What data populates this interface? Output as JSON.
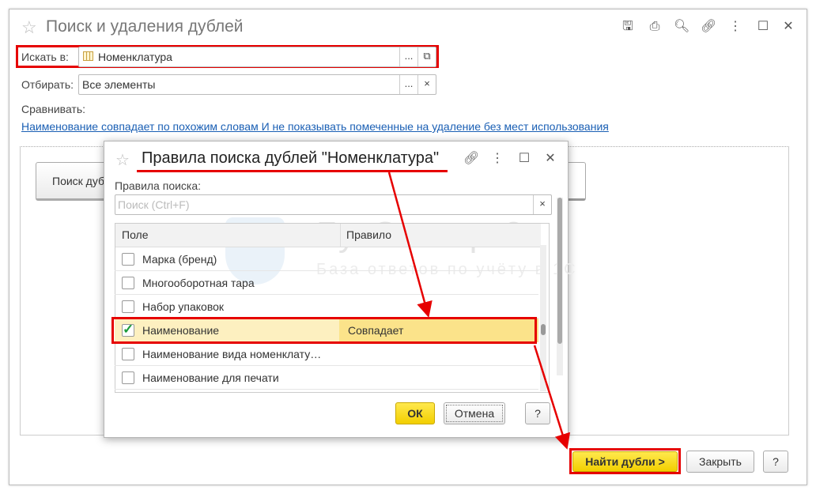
{
  "window": {
    "title": "Поиск и удаления дублей",
    "toolbar_icons": [
      "save-icon",
      "print-icon",
      "preview-icon",
      "link-icon",
      "more-icon",
      "maximize-icon",
      "close-icon"
    ]
  },
  "search_in": {
    "label": "Искать в:",
    "value": "Номенклатура",
    "select_btn": "...",
    "open_btn": "⧉"
  },
  "filter": {
    "label": "Отбирать:",
    "value": "Все элементы",
    "select_btn": "...",
    "clear_btn": "×"
  },
  "compare": {
    "label": "Сравнивать:",
    "link": "Наименование совпадает по похожим словам И не показывать помеченные на удаление без мест использования"
  },
  "background": {
    "search_button": "Поиск дубл"
  },
  "dialog": {
    "title": "Правила поиска дублей \"Номенклатура\"",
    "rules_label": "Правила поиска:",
    "search_placeholder": "Поиск (Ctrl+F)",
    "columns": [
      "Поле",
      "Правило"
    ],
    "rows": [
      {
        "field": "Марка (бренд)",
        "rule": "",
        "checked": false
      },
      {
        "field": "Многооборотная тара",
        "rule": "",
        "checked": false
      },
      {
        "field": "Набор упаковок",
        "rule": "",
        "checked": false
      },
      {
        "field": "Наименование",
        "rule": "Совпадает",
        "checked": true
      },
      {
        "field": "Наименование вида номенклату…",
        "rule": "",
        "checked": false
      },
      {
        "field": "Наименование для печати",
        "rule": "",
        "checked": false
      }
    ],
    "ok": "ОК",
    "cancel": "Отмена",
    "help": "?"
  },
  "watermark": {
    "brand": "БухЭксперт8",
    "tagline": "База ответов по учёту в 1С"
  },
  "footer": {
    "find": "Найти дубли >",
    "close": "Закрыть",
    "help": "?"
  },
  "colors": {
    "highlight": "#e60000",
    "ok_yellow": "#f5d800",
    "selected_row": "#fbe38a"
  }
}
